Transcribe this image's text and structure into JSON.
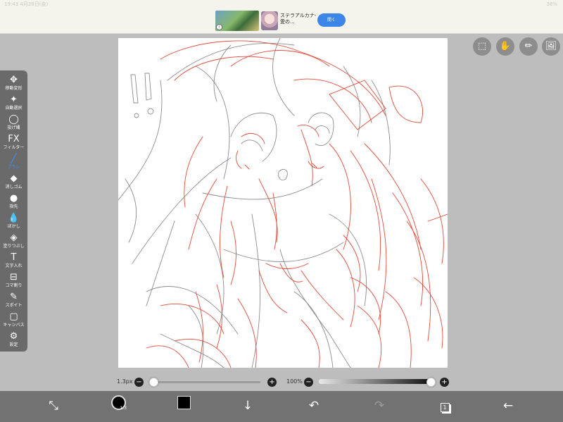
{
  "status": {
    "left": "19:43  4月28日(金)",
    "right": "38%"
  },
  "ad": {
    "info": "i",
    "close": "✕",
    "text": "ステラアルカナ-愛の...",
    "cta": "開く"
  },
  "toolbar": {
    "items": [
      {
        "icon": "move-transform-icon",
        "glyph": "✥",
        "label": "移動変形"
      },
      {
        "icon": "magic-wand-icon",
        "glyph": "✦",
        "label": "自動選択"
      },
      {
        "icon": "lasso-icon",
        "glyph": "◯",
        "label": "投げ縄"
      },
      {
        "icon": "filter-icon",
        "glyph": "FX",
        "label": "フィルター"
      },
      {
        "icon": "brush-icon",
        "glyph": "╱",
        "label": "ブラシ",
        "active": true
      },
      {
        "icon": "eraser-icon",
        "glyph": "◆",
        "label": "消しゴム"
      },
      {
        "icon": "finger-icon",
        "glyph": "●",
        "label": "指先"
      },
      {
        "icon": "blur-icon",
        "glyph": "💧",
        "label": "ぼかし"
      },
      {
        "icon": "fill-icon",
        "glyph": "◈",
        "label": "塗りつぶし"
      },
      {
        "icon": "text-icon",
        "glyph": "T",
        "label": "文字入れ"
      },
      {
        "icon": "frame-divider-icon",
        "glyph": "⊟",
        "label": "コマ割り"
      },
      {
        "icon": "eyedropper-icon",
        "glyph": "✎",
        "label": "スポイト"
      },
      {
        "icon": "canvas-icon",
        "glyph": "▢",
        "label": "キャンバス"
      },
      {
        "icon": "settings-gear-icon",
        "glyph": "⚙",
        "label": "設定"
      }
    ]
  },
  "topright": [
    {
      "icon": "selection-icon",
      "glyph": "⬚"
    },
    {
      "icon": "hand-icon",
      "glyph": "✋"
    },
    {
      "icon": "ruler-icon",
      "glyph": "✏"
    },
    {
      "icon": "image-icon",
      "glyph": "🖼"
    }
  ],
  "brush": {
    "size_label": "1.3px",
    "size_fraction": 0.02,
    "opacity_label": "100%",
    "opacity_fraction": 1.0
  },
  "bottombar": {
    "transform_icon": "⤡",
    "color_size": "1.3",
    "download_icon": "↓",
    "undo_icon": "↶",
    "redo_icon": "↷",
    "layers_icon": "1",
    "back_icon": "←"
  },
  "colors": {
    "accent": "#3c8cff",
    "sketch": "#e04a3a",
    "toolbar": "#6a6a6a"
  }
}
